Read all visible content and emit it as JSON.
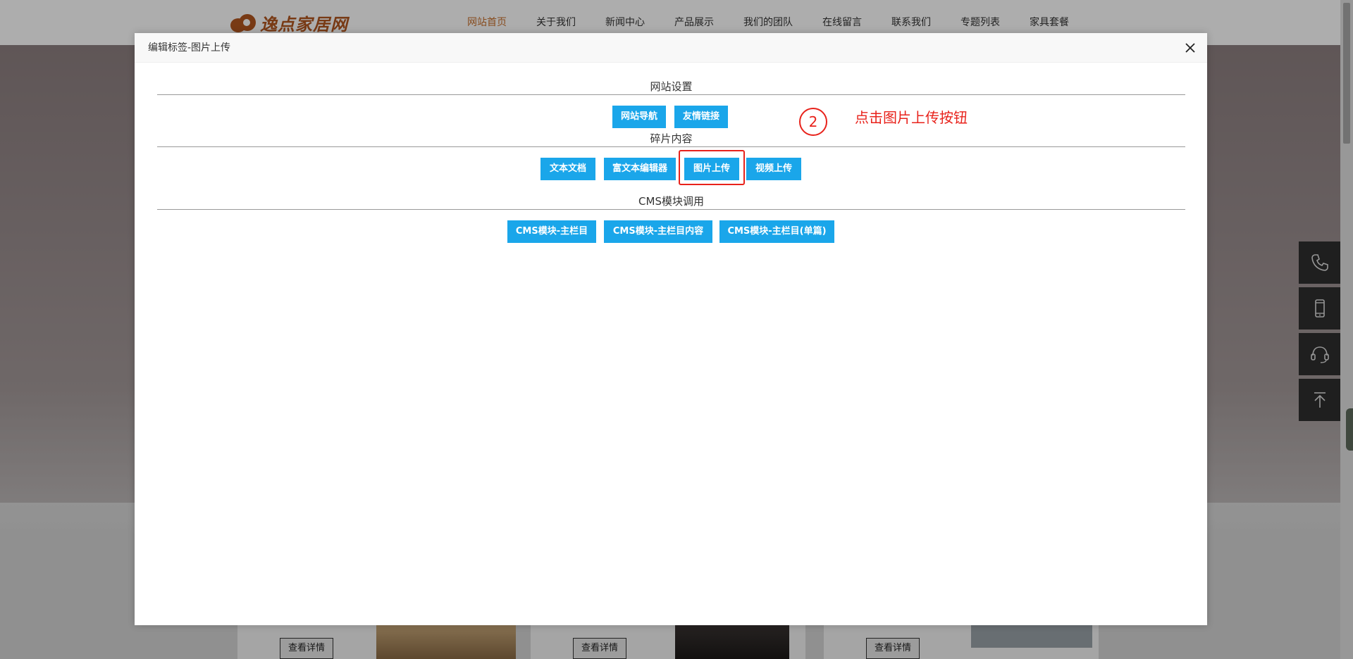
{
  "site": {
    "logo_text": "逸点家居网",
    "nav": [
      {
        "label": "网站首页",
        "active": true
      },
      {
        "label": "关于我们",
        "active": false
      },
      {
        "label": "新闻中心",
        "active": false
      },
      {
        "label": "产品展示",
        "active": false
      },
      {
        "label": "我们的团队",
        "active": false
      },
      {
        "label": "在线留言",
        "active": false
      },
      {
        "label": "联系我们",
        "active": false
      },
      {
        "label": "专题列表",
        "active": false
      },
      {
        "label": "家具套餐",
        "active": false
      }
    ],
    "detail_buttons": [
      "查看详情",
      "查看详情",
      "查看详情"
    ],
    "side_buttons": [
      "phone-icon",
      "mobile-icon",
      "headset-icon",
      "back-to-top-icon"
    ]
  },
  "modal": {
    "title": "编辑标签-图片上传",
    "sections": [
      {
        "title": "网站设置",
        "buttons": [
          "网站导航",
          "友情链接"
        ]
      },
      {
        "title": "碎片内容",
        "buttons": [
          "文本文档",
          "富文本编辑器",
          "图片上传",
          "视频上传"
        ]
      },
      {
        "title": "CMS模块调用",
        "buttons": [
          "CMS模块-主栏目",
          "CMS模块-主栏目内容",
          "CMS模块-主栏目(单篇)"
        ]
      }
    ]
  },
  "annotation": {
    "step_number": "2",
    "instruction": "点击图片上传按钮",
    "color": "#e8221b"
  },
  "colors": {
    "button": "#1aa6ea",
    "nav_active": "#c8712d",
    "brand": "#b2561f"
  }
}
